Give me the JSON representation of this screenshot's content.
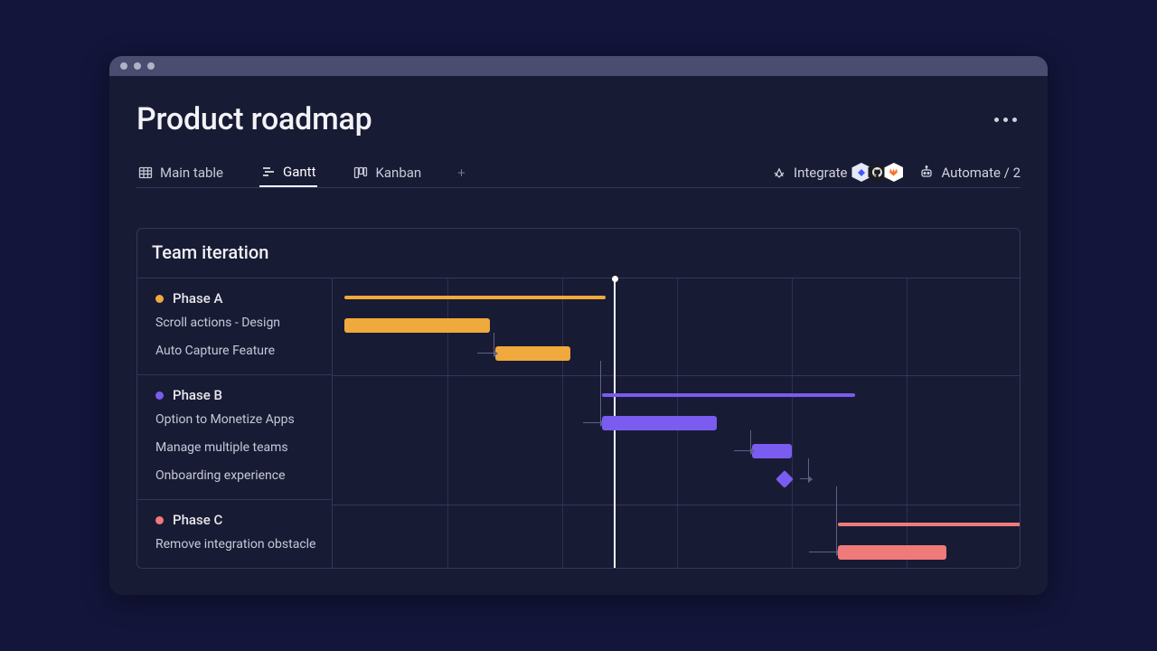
{
  "page": {
    "title": "Product roadmap"
  },
  "tabs": [
    {
      "label": "Main table",
      "icon": "table-icon",
      "active": false
    },
    {
      "label": "Gantt",
      "icon": "gantt-icon",
      "active": true
    },
    {
      "label": "Kanban",
      "icon": "kanban-icon",
      "active": false
    }
  ],
  "actions": {
    "integrate_label": "Integrate",
    "automate_label": "Automate / 2"
  },
  "board": {
    "title": "Team iteration"
  },
  "groups": [
    {
      "label": "Phase A",
      "color": "#f0a93c",
      "tasks": [
        {
          "label": "Scroll actions - Design"
        },
        {
          "label": "Auto Capture Feature"
        }
      ]
    },
    {
      "label": "Phase B",
      "color": "#7a5cf0",
      "tasks": [
        {
          "label": "Option to Monetize Apps"
        },
        {
          "label": "Manage multiple teams"
        },
        {
          "label": "Onboarding experience"
        }
      ]
    },
    {
      "label": "Phase C",
      "color": "#f07a7a",
      "tasks": [
        {
          "label": "Remove integration obstacle"
        }
      ]
    }
  ],
  "chart_data": {
    "type": "gantt",
    "x_unit": "column",
    "x_range": [
      0,
      6
    ],
    "today_marker_x": 2.45,
    "phases": [
      {
        "name": "Phase A",
        "color": "#f0a93c",
        "summary_bar": {
          "start": 0.1,
          "end": 2.38
        },
        "tasks": [
          {
            "name": "Scroll actions - Design",
            "start": 0.1,
            "end": 1.37,
            "depends_on": null
          },
          {
            "name": "Auto Capture Feature",
            "start": 1.42,
            "end": 2.07,
            "depends_on": "Scroll actions - Design"
          }
        ]
      },
      {
        "name": "Phase B",
        "color": "#7a5cf0",
        "summary_bar": {
          "start": 2.35,
          "end": 4.55
        },
        "tasks": [
          {
            "name": "Option to Monetize Apps",
            "start": 2.35,
            "end": 3.35,
            "depends_on": "Auto Capture Feature"
          },
          {
            "name": "Manage multiple teams",
            "start": 3.65,
            "end": 4.0,
            "depends_on": "Option to Monetize Apps"
          },
          {
            "name": "Onboarding experience",
            "start": 3.94,
            "end": 3.94,
            "milestone": true,
            "depends_on": "Manage multiple teams"
          }
        ]
      },
      {
        "name": "Phase C",
        "color": "#f07a7a",
        "summary_bar": {
          "start": 4.4,
          "end": 6.0
        },
        "tasks": [
          {
            "name": "Remove integration obstacle",
            "start": 4.4,
            "end": 5.35,
            "depends_on": "Onboarding experience"
          }
        ]
      }
    ]
  }
}
